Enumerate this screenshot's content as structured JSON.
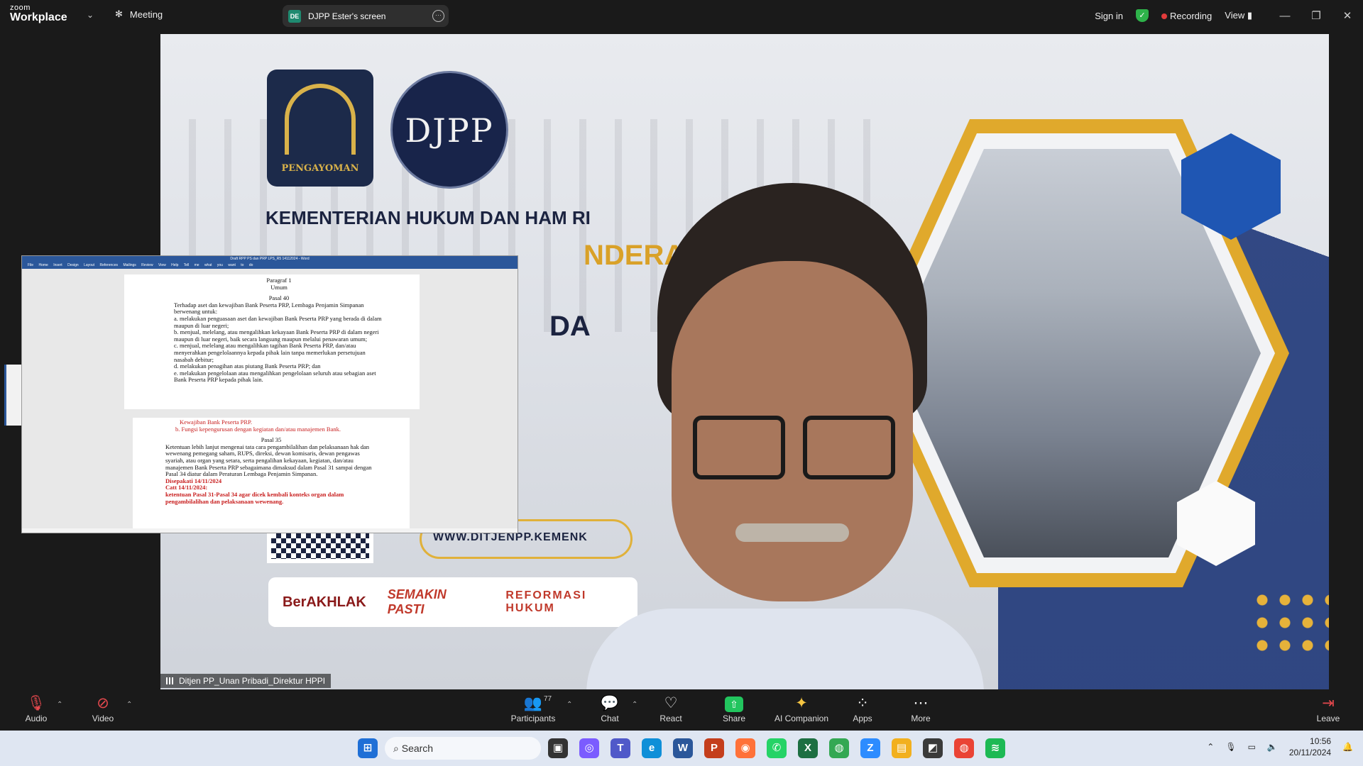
{
  "app": {
    "brand_line1": "zoom",
    "brand_line2": "Workplace",
    "meeting_label": "Meeting"
  },
  "share_pill": {
    "initials": "DE",
    "label": "DJPP Ester's screen"
  },
  "top_right": {
    "sign_in": "Sign in",
    "recording": "Recording",
    "view": "View"
  },
  "video": {
    "logo1_label": "PENGAYOMAN",
    "logo2_label": "DJPP",
    "heading": "KEMENTERIAN HUKUM DAN HAM RI",
    "heading_fragment2": "NDERA",
    "heading_fragment3": "DA",
    "url": "WWW.DITJENPP.KEMENK",
    "banner": [
      "BerAKHLAK",
      "SEMAKIN PASTI",
      "REFORMASI HUKUM"
    ],
    "name_tag": "Ditjen PP_Unan Pribadi_Direktur HPPI"
  },
  "doc": {
    "title": "Draft RPP PS dan PRP LPS_R5 14112024 - Word",
    "ribbon": [
      "File",
      "Home",
      "Insert",
      "Design",
      "Layout",
      "References",
      "Mailings",
      "Review",
      "View",
      "Help",
      "Tell me what you want to do"
    ],
    "page1": {
      "para_title": "Paragraf 1",
      "para_sub": "Umum",
      "pasal": "Pasal 40",
      "intro": "Terhadap aset dan kewajiban Bank Peserta PRP, Lembaga Penjamin Simpanan berwenang untuk:",
      "items": [
        "a. melakukan penguasaan aset dan kewajiban Bank Peserta PRP yang berada di dalam maupun di luar negeri;",
        "b. menjual, melelang, atau mengalihkan kekayaan Bank Peserta PRP di dalam negeri maupun di luar negeri, baik secara langsung maupun melalui penawaran umum;",
        "c. menjual, melelang atau mengalihkan tagihan Bank Peserta PRP, dan/atau menyerahkan pengelolaannya kepada pihak lain tanpa memerlukan persetujuan nasabah debitur;",
        "d. melakukan penagihan atas piutang Bank Peserta PRP; dan",
        "e. melakukan pengelolaan atau mengalihkan pengelolaan seluruh atau sebagian aset Bank Peserta PRP kepada pihak lain."
      ]
    },
    "page2": {
      "red_a": "Kewajiban Bank Peserta PRP.",
      "red_b": "b. Fungsi kepengurusan dengan kegiatan dan/atau manajemen Bank.",
      "pasal": "Pasal 35",
      "body": "Ketentuan lebih lanjut mengenai tata cara pengambilalihan dan pelaksanaan hak dan wewenang pemegang saham, RUPS, direksi, dewan komisaris, dewan pengawas syariah, atau organ yang setara, serta pengalihan kekayaan, kegiatan, dan/atau manajemen Bank Peserta PRP sebagaimana dimaksud dalam Pasal 31 sampai dengan Pasal 34 diatur dalam Peraturan Lembaga Penjamin Simpanan.",
      "agreed": "Disepakati 14/11/2024",
      "note_title": "Catt 14/11/2024:",
      "note": "ketentuan Pasal 31-Pasal 34 agar dicek kembali konteks organ dalam pengambilalihan dan pelaksanaan wewenang."
    }
  },
  "toolbar": {
    "audio": "Audio",
    "video": "Video",
    "participants": "Participants",
    "participants_count": "77",
    "chat": "Chat",
    "react": "React",
    "share": "Share",
    "ai": "AI Companion",
    "apps": "Apps",
    "more": "More",
    "leave": "Leave"
  },
  "taskbar": {
    "search_placeholder": "Search",
    "time": "10:56",
    "date": "20/11/2024"
  },
  "colors": {
    "accent_green": "#22c55e",
    "recording_red": "#e23b3b",
    "leave_red": "#e5484d",
    "word_blue": "#2b579a"
  }
}
